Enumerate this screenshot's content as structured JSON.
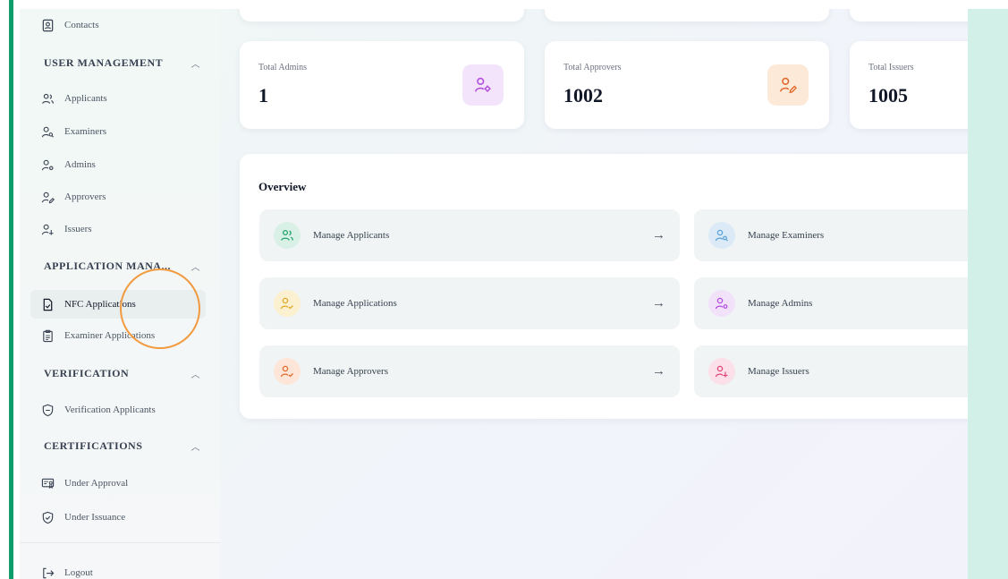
{
  "sidebar": {
    "contacts": "Contacts",
    "user_management": {
      "title": "USER MANAGEMENT",
      "items": [
        "Applicants",
        "Examiners",
        "Admins",
        "Approvers",
        "Issuers"
      ]
    },
    "application_management": {
      "title": "APPLICATION MANA...",
      "items": [
        "NFC Applications",
        "Examiner Applications"
      ]
    },
    "verification": {
      "title": "VERIFICATION",
      "items": [
        "Verification Applicants"
      ]
    },
    "certifications": {
      "title": "CERTIFICATIONS",
      "items": [
        "Under Approval",
        "Under Issuance"
      ]
    },
    "logout": "Logout",
    "active_item": "NFC Applications"
  },
  "stats": [
    {
      "label": "Total Admins",
      "value": "1",
      "icon": "admin-gear-icon",
      "icon_bg": "#f3e3fb",
      "icon_color": "#b14de0"
    },
    {
      "label": "Total Approvers",
      "value": "1002",
      "icon": "approver-edit-icon",
      "icon_bg": "#fde9d8",
      "icon_color": "#e26a2c"
    },
    {
      "label": "Total Issuers",
      "value": "1005"
    }
  ],
  "overview": {
    "title": "Overview",
    "tiles": [
      {
        "label": "Manage Applicants",
        "icon": "users-icon",
        "bg": "#d9f0e6",
        "color": "#21a36b"
      },
      {
        "label": "Manage Examiners",
        "icon": "user-search-icon",
        "bg": "#dbeaf6",
        "color": "#5aa1d8"
      },
      {
        "label": "Manage Applications",
        "icon": "user-check-icon",
        "bg": "#fbf0cf",
        "color": "#e0a928"
      },
      {
        "label": "Manage Admins",
        "icon": "user-admin-icon",
        "bg": "#f1e2fa",
        "color": "#b14de0"
      },
      {
        "label": "Manage Approvers",
        "icon": "user-approve-icon",
        "bg": "#fde6d8",
        "color": "#e26a2c"
      },
      {
        "label": "Manage Issuers",
        "icon": "user-issue-icon",
        "bg": "#fbe0ea",
        "color": "#e0457b"
      }
    ],
    "arrow": "→"
  }
}
